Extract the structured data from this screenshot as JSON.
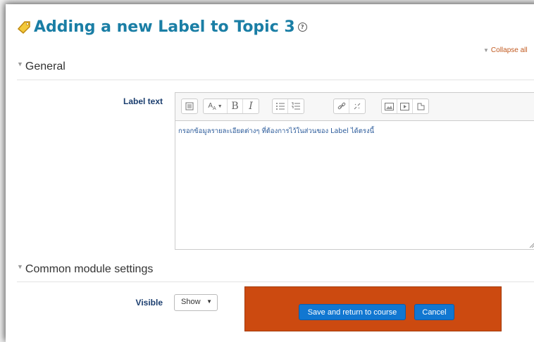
{
  "page": {
    "title": "Adding a new Label to Topic 3",
    "title_icon": "tag-icon",
    "help_icon": "question-circle-icon",
    "collapse_all": "Collapse all"
  },
  "sections": {
    "general": {
      "legend": "General"
    },
    "common": {
      "legend": "Common module settings"
    }
  },
  "label_text": {
    "label": "Label text",
    "content": "กรอกข้อมูลรายละเอียดต่างๆ ที่ต้องการไว้ในส่วนของ Label ได้ตรงนี้",
    "toolbar_icons": [
      "show-more-buttons-icon",
      "font-style-icon",
      "bold-icon",
      "italic-icon",
      "unordered-list-icon",
      "ordered-list-icon",
      "link-icon",
      "unlink-icon",
      "insert-image-icon",
      "insert-media-icon",
      "manage-files-icon"
    ]
  },
  "visible": {
    "label": "Visible",
    "value": "Show"
  },
  "buttons": {
    "save": "Save and return to course",
    "cancel": "Cancel"
  },
  "colors": {
    "heading": "#1a7ea5",
    "primary_button": "#1177d1",
    "highlight_box": "#cc4a10",
    "collapse_link": "#c15a20"
  }
}
